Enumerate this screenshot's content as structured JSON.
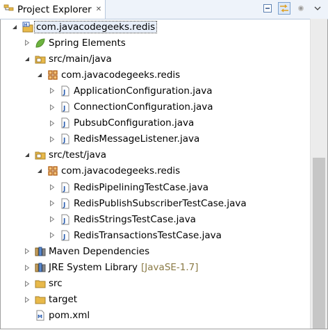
{
  "view": {
    "tab_title": "Project Explorer",
    "tab_close": "✕",
    "toolbar": [
      {
        "name": "collapse-all-icon"
      },
      {
        "name": "link-with-editor-icon",
        "active": true
      },
      {
        "name": "focus-on-active-task-icon"
      },
      {
        "name": "view-menu-icon"
      }
    ]
  },
  "tree": [
    {
      "depth": 0,
      "expanded": true,
      "icon": "maven-project-icon",
      "label": "com.javacodegeeks.redis",
      "selected": true
    },
    {
      "depth": 1,
      "expanded": false,
      "icon": "spring-leaf-icon",
      "label": "Spring Elements"
    },
    {
      "depth": 1,
      "expanded": true,
      "icon": "source-folder-icon",
      "label": "src/main/java"
    },
    {
      "depth": 2,
      "expanded": true,
      "icon": "package-icon",
      "label": "com.javacodegeeks.redis"
    },
    {
      "depth": 3,
      "expanded": false,
      "icon": "java-file-icon",
      "label": "ApplicationConfiguration.java"
    },
    {
      "depth": 3,
      "expanded": false,
      "icon": "java-file-icon",
      "label": "ConnectionConfiguration.java"
    },
    {
      "depth": 3,
      "expanded": false,
      "icon": "java-file-icon",
      "label": "PubsubConfiguration.java"
    },
    {
      "depth": 3,
      "expanded": false,
      "icon": "java-file-icon",
      "label": "RedisMessageListener.java"
    },
    {
      "depth": 1,
      "expanded": true,
      "icon": "source-folder-icon",
      "label": "src/test/java"
    },
    {
      "depth": 2,
      "expanded": true,
      "icon": "package-icon",
      "label": "com.javacodegeeks.redis"
    },
    {
      "depth": 3,
      "expanded": false,
      "icon": "java-file-icon",
      "label": "RedisPipeliningTestCase.java"
    },
    {
      "depth": 3,
      "expanded": false,
      "icon": "java-file-icon",
      "label": "RedisPublishSubscriberTestCase.java"
    },
    {
      "depth": 3,
      "expanded": false,
      "icon": "java-file-icon",
      "label": "RedisStringsTestCase.java"
    },
    {
      "depth": 3,
      "expanded": false,
      "icon": "java-file-icon",
      "label": "RedisTransactionsTestCase.java"
    },
    {
      "depth": 1,
      "expanded": false,
      "icon": "library-icon",
      "label": "Maven Dependencies"
    },
    {
      "depth": 1,
      "expanded": false,
      "icon": "library-icon",
      "label": "JRE System Library",
      "decoration": "[JavaSE-1.7]"
    },
    {
      "depth": 1,
      "expanded": false,
      "icon": "folder-icon",
      "label": "src"
    },
    {
      "depth": 1,
      "expanded": false,
      "icon": "folder-icon",
      "label": "target"
    },
    {
      "depth": 1,
      "leaf": true,
      "icon": "xml-file-icon",
      "label": "pom.xml"
    }
  ],
  "colors": {
    "folder": "#e8b94a",
    "package": "#b5651d",
    "java": "#2a5db0",
    "spring": "#6db33f",
    "selection": "#e7eef9",
    "decoration": "#8a7a45"
  }
}
